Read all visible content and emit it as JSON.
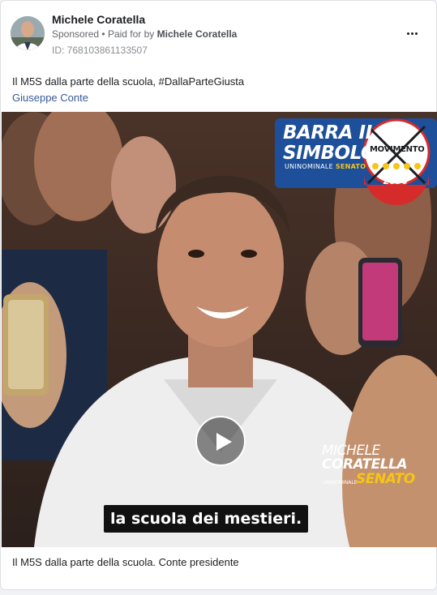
{
  "post": {
    "author": "Michele Coratella",
    "sponsored_label": "Sponsored",
    "paid_prefix": "Paid for by",
    "paid_by": "Michele Coratella",
    "ad_id": "ID: 768103861133507",
    "body_text": "Il M5S dalla parte della scuola, #DallaParteGiusta",
    "link_text": "Giuseppe Conte",
    "footer_text": "Il M5S dalla parte della scuola. Conte presidente"
  },
  "video": {
    "badge_line1": "BARRA IL",
    "badge_line2": "SIMBOLO",
    "badge_sub": "UNINOMINALE",
    "badge_sub_highlight": "SENATO",
    "logo_text": "MOVIMENTO",
    "logo_year": "2050",
    "candidate_first": "MICHELE",
    "candidate_last": "CORATELLA",
    "candidate_sub": "UNINOMINALE",
    "candidate_role": "SENATO",
    "caption": "la scuola dei mestieri."
  },
  "colors": {
    "link": "#385898",
    "accent_yellow": "#f5c518",
    "badge_blue": "#1e4f9a",
    "logo_red": "#d62b2b"
  },
  "icons": {
    "more": "more-horizontal-icon",
    "play": "play-icon"
  }
}
